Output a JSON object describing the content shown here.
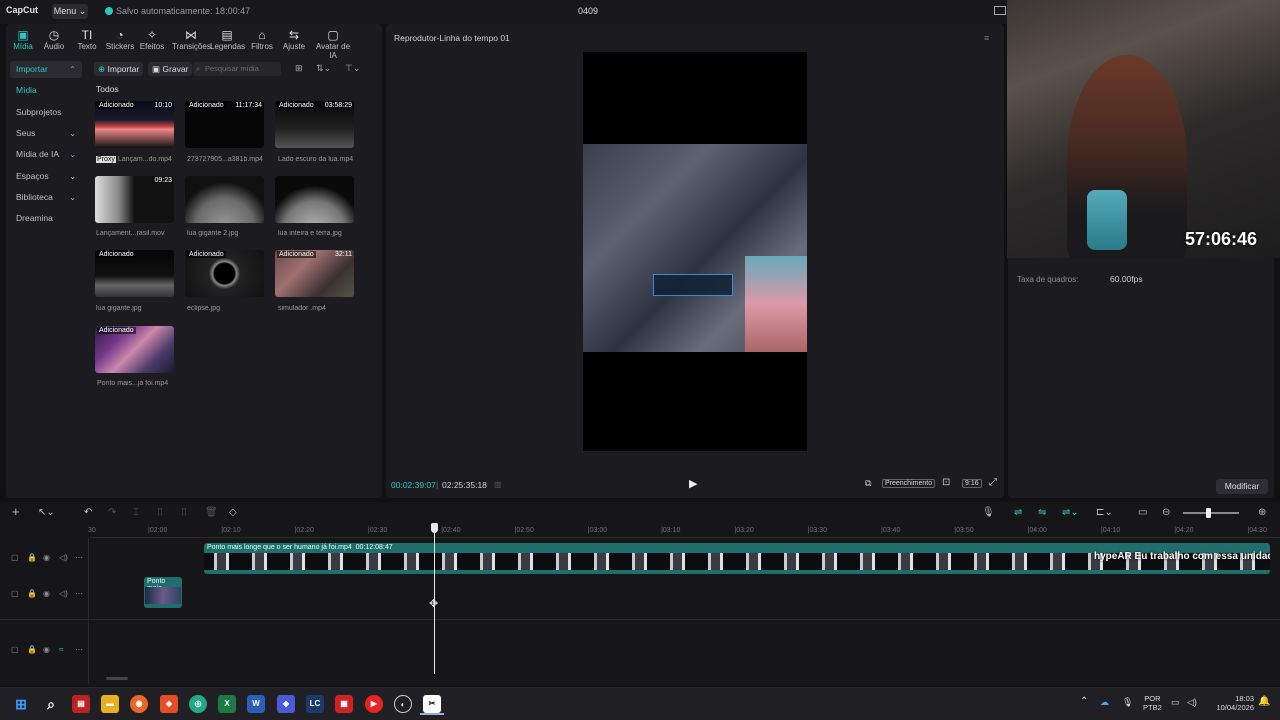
{
  "app": {
    "logo": "CapCut",
    "menu_label": "Menu",
    "save_status": "Salvo automaticamente: 18:00:47",
    "project_name": "0409"
  },
  "toolbar": {
    "tools": [
      {
        "label": "Mídia",
        "icon": "media-icon",
        "active": true
      },
      {
        "label": "Áudio",
        "icon": "audio-icon"
      },
      {
        "label": "Texto",
        "icon": "text-icon"
      },
      {
        "label": "Stickers",
        "icon": "sticker-icon"
      },
      {
        "label": "Efeitos",
        "icon": "effects-icon"
      },
      {
        "label": "Transições",
        "icon": "transitions-icon"
      },
      {
        "label": "Legendas",
        "icon": "captions-icon"
      },
      {
        "label": "Filtros",
        "icon": "filters-icon"
      },
      {
        "label": "Ajuste",
        "icon": "adjust-icon"
      },
      {
        "label": "Avatar de IA",
        "icon": "ai-avatar-icon"
      }
    ]
  },
  "side_nav": {
    "items": [
      {
        "label": "Importar",
        "chevron": true
      },
      {
        "label": "Mídia"
      },
      {
        "label": "Subprojetos"
      },
      {
        "label": "Seus",
        "chevron": true
      },
      {
        "label": "Mídia de IA",
        "chevron": true
      },
      {
        "label": "Espaços",
        "chevron": true
      },
      {
        "label": "Biblioteca",
        "chevron": true
      },
      {
        "label": "Dreamina"
      }
    ]
  },
  "media": {
    "import_label": "Importar",
    "record_label": "Gravar",
    "search_placeholder": "Pesquisar mídia",
    "section_label": "Todos",
    "items": [
      {
        "name": "Lançam...do.mp4",
        "badge": "Adicionado",
        "duration": "10:10",
        "proxy": "Proxy"
      },
      {
        "name": "273727905...a381b.mp4",
        "badge": "Adicionado",
        "duration": "11:17:34"
      },
      {
        "name": "Lado escuro da lua.mp4",
        "badge": "Adicionado",
        "duration": "03:58:29"
      },
      {
        "name": "Lançament...rasil.mov",
        "duration": "09:23"
      },
      {
        "name": "lua gigante 2.jpg"
      },
      {
        "name": "lua inteira e terra.jpg"
      },
      {
        "name": "lua gigante.jpg",
        "badge": "Adicionado"
      },
      {
        "name": "eclipse.jpg",
        "badge": "Adicionado"
      },
      {
        "name": "simulador .mp4",
        "badge": "Adicionado",
        "duration": "32:11"
      },
      {
        "name": "Ponto mais...já foi.mp4",
        "badge": "Adicionado"
      }
    ]
  },
  "player": {
    "title": "Reprodutor-Linha do tempo 01",
    "current_time": "00:02:39:07",
    "total_time": "02:25:35:18",
    "fill_label": "Preenchimento",
    "ratio_label": "9:16"
  },
  "properties": {
    "fps_label": "Taxa de quadros:",
    "fps_value": "60.00fps",
    "modify_label": "Modificar"
  },
  "webcam": {
    "timer": "57:06:46"
  },
  "timeline": {
    "ruler_labels": [
      "30",
      "|02:00",
      "|02:10",
      "|02:20",
      "|02:30",
      "|02:40",
      "|02:50",
      "|03:00",
      "|03:10",
      "|03:20",
      "|03:30",
      "|03:40",
      "|03:50",
      "|04:00",
      "|04:10",
      "|04:20",
      "|04:30"
    ],
    "main_clip_label": "Ponto mais longe que o ser humano já foi.mp4",
    "main_clip_duration": "00:12:08:47",
    "overlay_text": "hypeAR   Eu trabalho com essa unidade",
    "small_clip_label": "Ponto mais"
  },
  "taskbar": {
    "lang_top": "POR",
    "lang_bottom": "PTB2",
    "time": "18:03",
    "date": "10/04/2026"
  },
  "colors": {
    "accent": "#2bc9c2",
    "clip": "#1f6e6c"
  }
}
